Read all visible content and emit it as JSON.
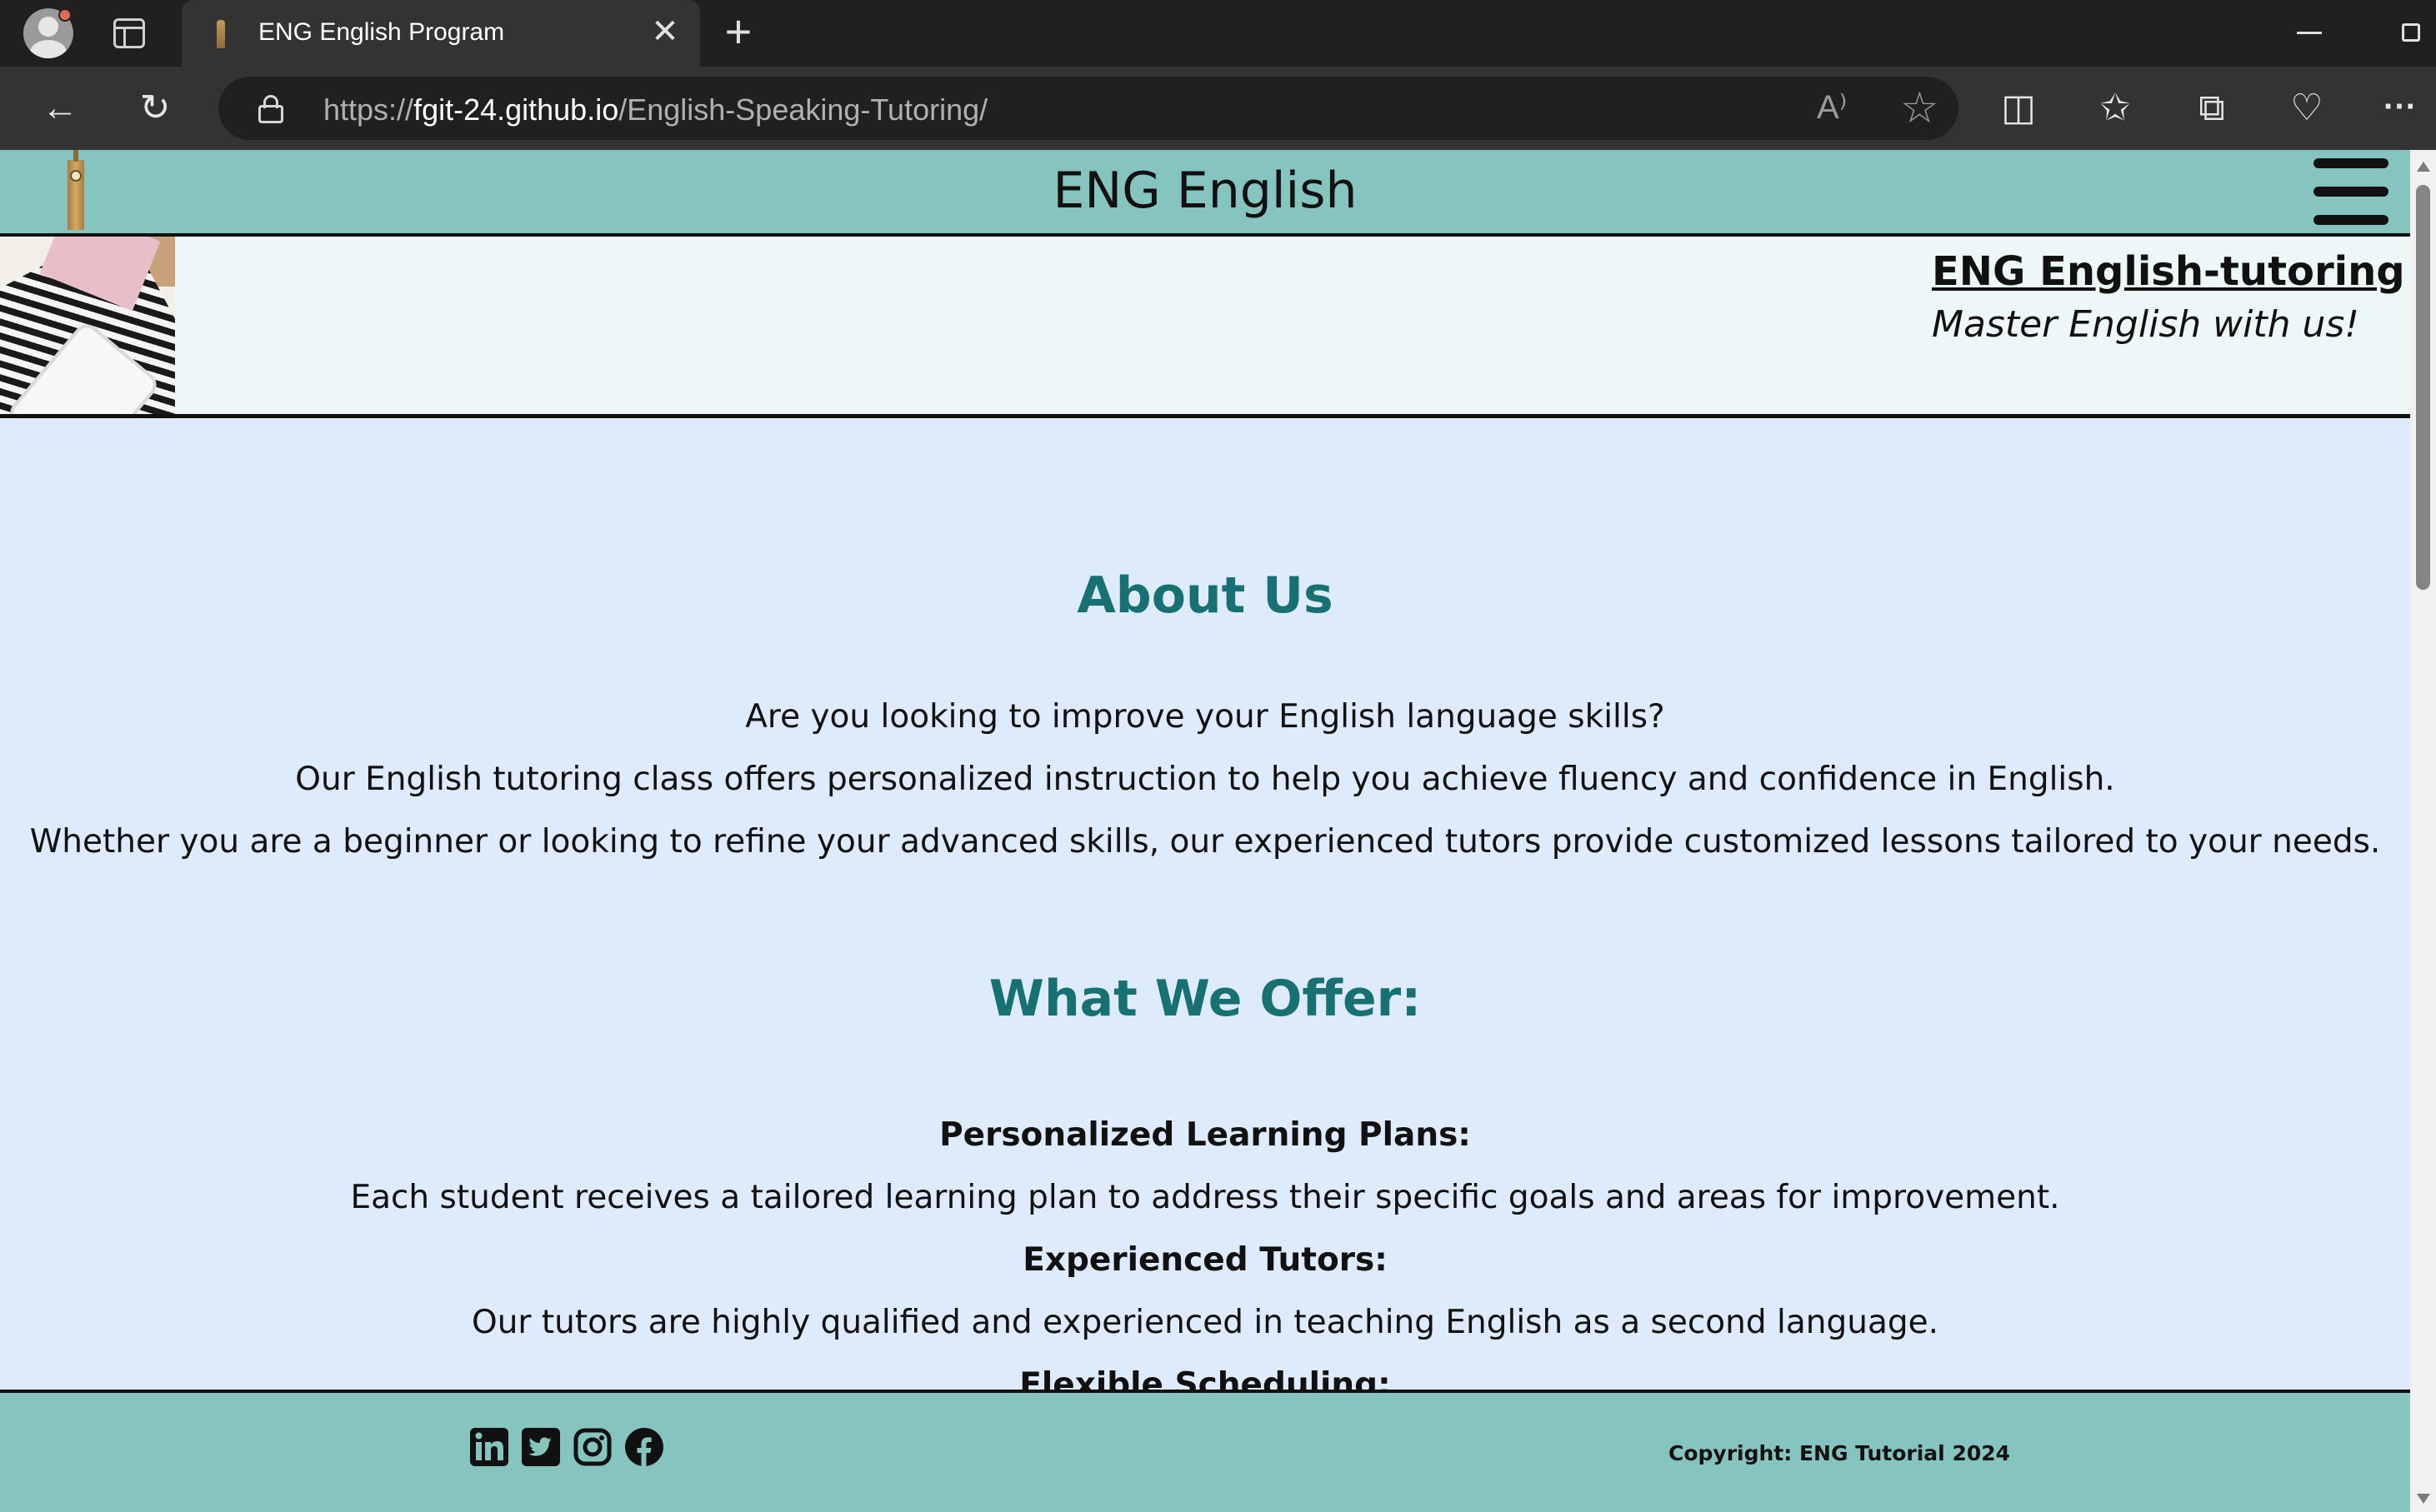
{
  "browser": {
    "tab_title": "ENG English Program",
    "new_tab_label": "+",
    "tab_close_label": "✕",
    "url_prefix": "https://",
    "url_host": "fgit-24.github.io",
    "url_path": "/English-Speaking-Tutoring/",
    "icons": [
      "profile-icon",
      "tab-actions-icon",
      "back-icon",
      "refresh-icon",
      "lock-icon",
      "read-aloud-icon",
      "favorite-star-icon",
      "split-screen-icon",
      "favorites-icon",
      "collections-icon",
      "browser-essentials-icon",
      "more-icon",
      "minimize-icon",
      "restore-icon"
    ],
    "glyphs": {
      "back": "←",
      "refresh": "↻",
      "read_aloud": "A⁾",
      "star": "☆",
      "split": "◫",
      "favorites": "✩",
      "collections": "⧉",
      "essentials": "♡",
      "more": "···"
    }
  },
  "site": {
    "header_title": "ENG English",
    "hero_title": "ENG English-tutoring",
    "hero_subtitle": "Master English with us!",
    "about": {
      "heading": "About Us",
      "lines": [
        "Are you looking to improve your English language skills?",
        "Our English tutoring class offers personalized instruction to help you achieve fluency and confidence in English.",
        "Whether you are a beginner or looking to refine your advanced skills, our experienced tutors provide customized lessons tailored to your needs."
      ]
    },
    "offer": {
      "heading": "What We Offer:",
      "items": [
        {
          "title": "Personalized Learning Plans:",
          "text": "Each student receives a tailored learning plan to address their specific goals and areas for improvement."
        },
        {
          "title": "Experienced Tutors:",
          "text": "Our tutors are highly qualified and experienced in teaching English as a second language."
        },
        {
          "title": "Flexible Scheduling:",
          "text": ""
        }
      ]
    },
    "footer": {
      "social_icons": [
        "linkedin-icon",
        "twitter-icon",
        "instagram-icon",
        "facebook-icon"
      ],
      "copyright": "Copyright: ENG Tutorial 2024"
    },
    "colors": {
      "header_bg": "#85c4bf",
      "page_bg": "#ddebfd",
      "heading": "#177072",
      "hero_bg": "#eef7f8"
    }
  }
}
